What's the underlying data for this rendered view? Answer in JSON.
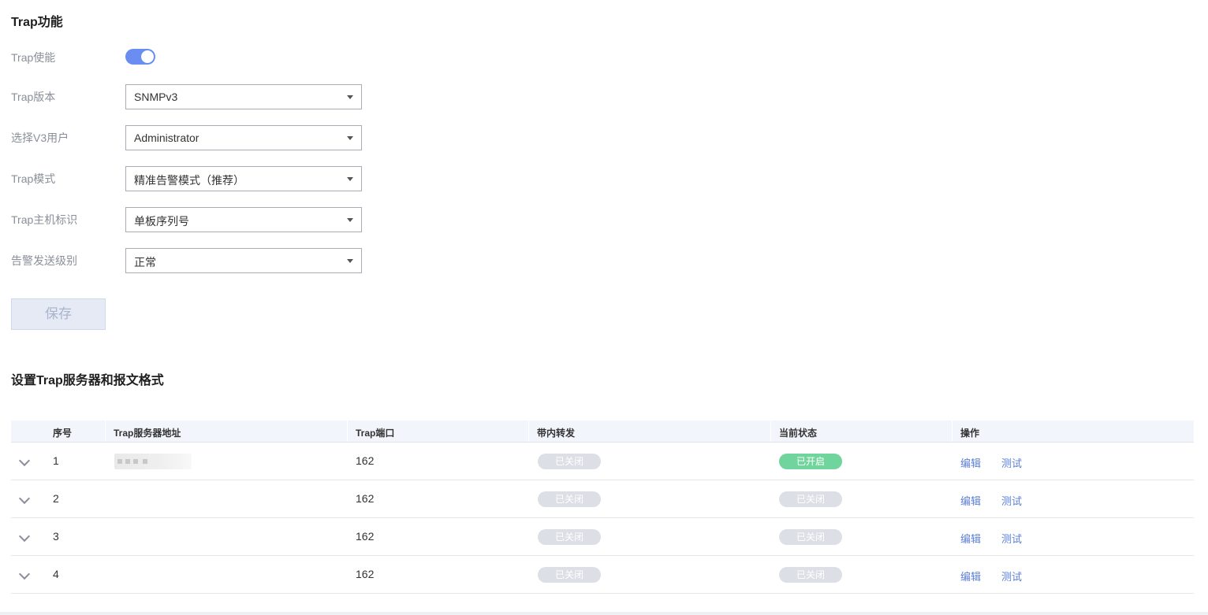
{
  "trap_section": {
    "title": "Trap功能",
    "enable_label": "Trap使能",
    "enabled": true,
    "version_label": "Trap版本",
    "version_value": "SNMPv3",
    "v3user_label": "选择V3用户",
    "v3user_value": "Administrator",
    "mode_label": "Trap模式",
    "mode_value": "精准告警模式（推荐）",
    "host_id_label": "Trap主机标识",
    "host_id_value": "单板序列号",
    "alarm_level_label": "告警发送级别",
    "alarm_level_value": "正常",
    "save_label": "保存"
  },
  "server_section": {
    "title": "设置Trap服务器和报文格式",
    "columns": [
      "序号",
      "Trap服务器地址",
      "Trap端口",
      "带内转发",
      "当前状态",
      "操作"
    ],
    "rows": [
      {
        "index": "1",
        "address": "",
        "port": "162",
        "inband": "已关闭",
        "status": "已开启",
        "status_on": true
      },
      {
        "index": "2",
        "address": "",
        "port": "162",
        "inband": "已关闭",
        "status": "已关闭",
        "status_on": false
      },
      {
        "index": "3",
        "address": "",
        "port": "162",
        "inband": "已关闭",
        "status": "已关闭",
        "status_on": false
      },
      {
        "index": "4",
        "address": "",
        "port": "162",
        "inband": "已关闭",
        "status": "已关闭",
        "status_on": false
      }
    ],
    "edit_label": "编辑",
    "test_label": "测试"
  },
  "colors": {
    "accent": "#6a8df2",
    "link": "#5a7fd6",
    "status_on": "#6fd59c",
    "status_off": "#dcdfe5"
  }
}
